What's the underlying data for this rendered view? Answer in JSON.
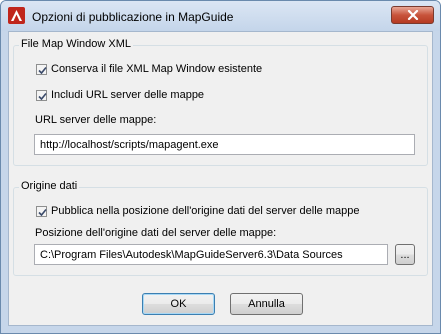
{
  "window": {
    "title": "Opzioni di pubblicazione in MapGuide"
  },
  "group_xml": {
    "legend": "File Map Window XML",
    "keep_existing_label": "Conserva il file XML Map Window esistente",
    "include_url_label": "Includi URL server delle mappe",
    "url_label": "URL server delle mappe:",
    "url_value": "http://localhost/scripts/mapagent.exe"
  },
  "group_source": {
    "legend": "Origine dati",
    "publish_label": "Pubblica nella posizione dell'origine dati del server delle mappe",
    "position_label": "Posizione dell'origine dati del server delle mappe:",
    "position_value": "C:\\Program Files\\Autodesk\\MapGuideServer6.3\\Data Sources",
    "browse_label": "..."
  },
  "buttons": {
    "ok_label": "OK",
    "cancel_label": "Annulla"
  },
  "colors": {
    "title_bg": "#c4d5ea",
    "close_red": "#c8543c",
    "client_bg": "#f0f0f0"
  }
}
